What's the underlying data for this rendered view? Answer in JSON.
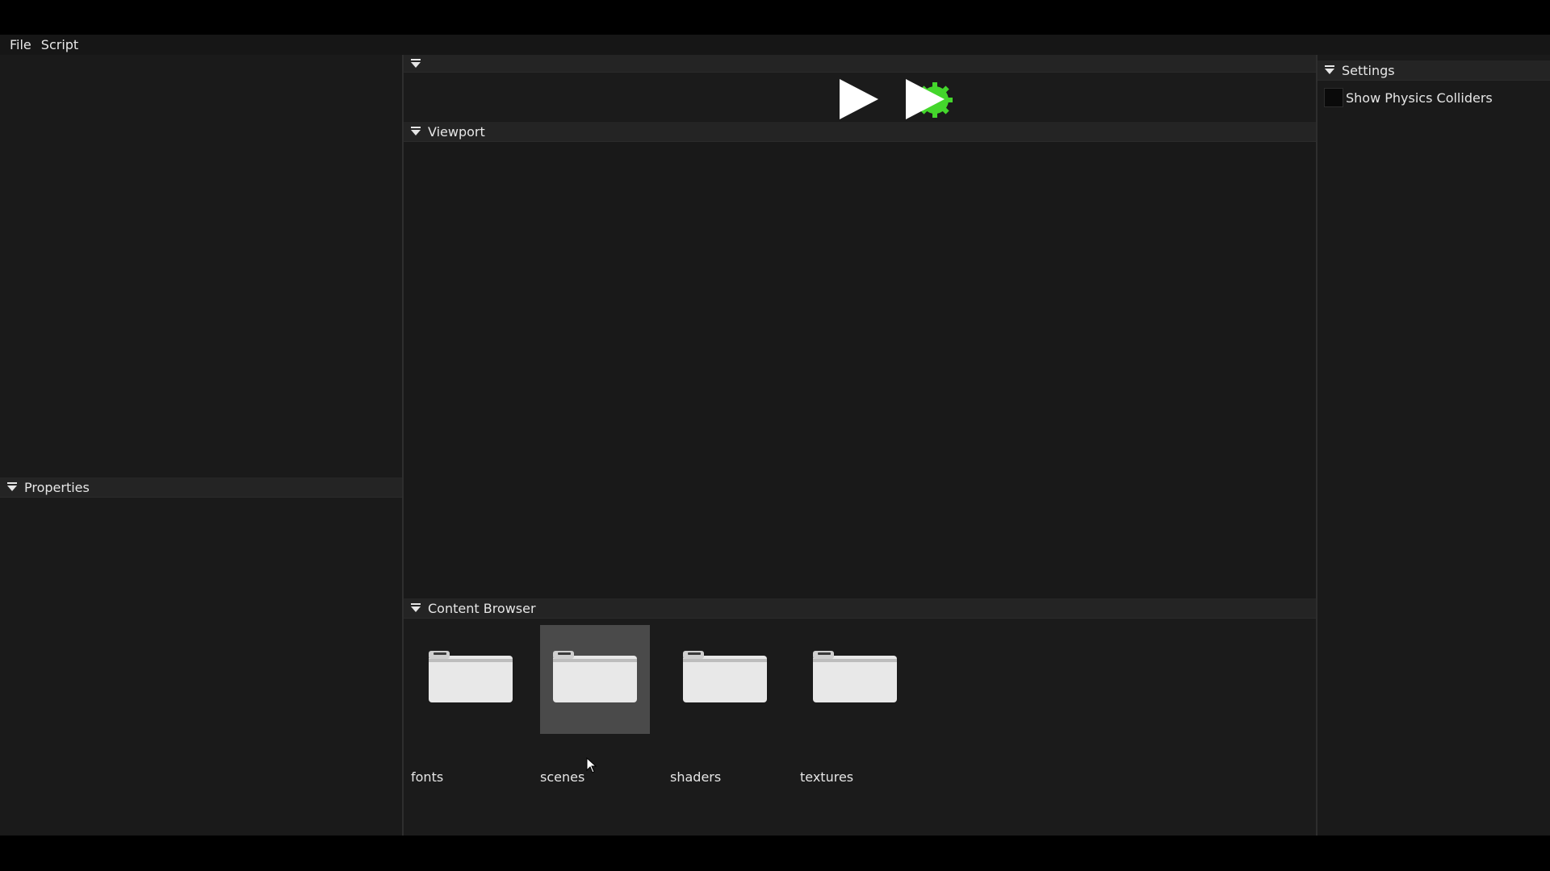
{
  "menu": {
    "file": "File",
    "script": "Script"
  },
  "panels": {
    "properties": {
      "title": "Properties"
    },
    "viewport": {
      "title": "Viewport"
    },
    "content_browser": {
      "title": "Content Browser",
      "items": [
        {
          "label": "fonts",
          "icon": "folder-icon",
          "selected": false
        },
        {
          "label": "scenes",
          "icon": "folder-icon",
          "selected": true
        },
        {
          "label": "shaders",
          "icon": "folder-icon",
          "selected": false
        },
        {
          "label": "textures",
          "icon": "folder-icon",
          "selected": false
        }
      ]
    },
    "settings": {
      "title": "Settings",
      "show_physics_colliders": {
        "label": "Show Physics Colliders",
        "checked": false
      }
    }
  },
  "toolbar": {
    "play_icon": "play-icon",
    "simulate_icon": "simulate-icon"
  },
  "colors": {
    "background": "#191919",
    "header": "#242424",
    "selected_item": "#4a4a4a",
    "simulate_accent": "#44d62c",
    "play_white": "#ffffff"
  }
}
